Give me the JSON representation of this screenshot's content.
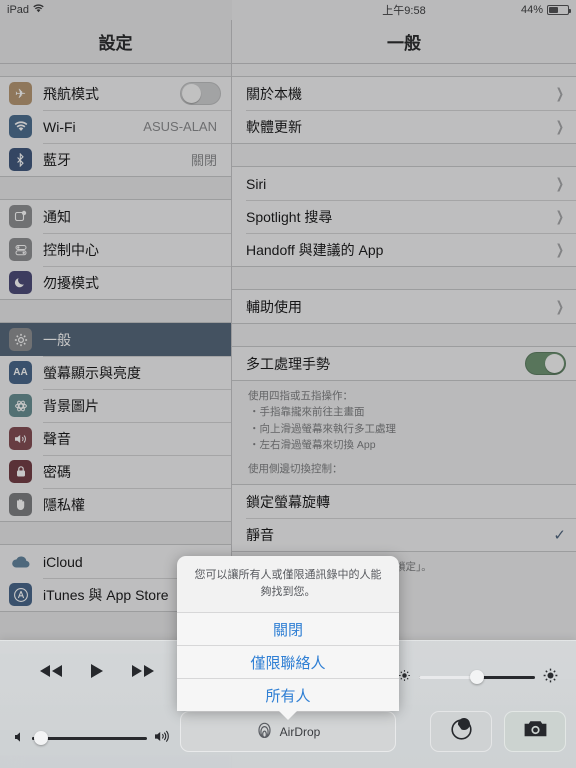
{
  "status_bar": {
    "device": "iPad",
    "wifi_icon": "wifi-icon",
    "time": "上午9:58",
    "battery_percent": "44%",
    "battery_level": 44
  },
  "sidebar": {
    "title": "設定",
    "groups": [
      {
        "items": [
          {
            "label": "飛航模式",
            "icon": "airplane-icon",
            "icon_color": "#e8922b",
            "control": "toggle",
            "toggle_on": false
          },
          {
            "label": "Wi-Fi",
            "icon": "wifi-icon",
            "icon_color": "#1a78d8",
            "value": "ASUS-ALAN"
          },
          {
            "label": "藍牙",
            "icon": "bluetooth-icon",
            "icon_color": "#1a5fc8",
            "value": "關閉"
          }
        ]
      },
      {
        "items": [
          {
            "label": "通知",
            "icon": "notifications-icon",
            "icon_color": "#8e9199"
          },
          {
            "label": "控制中心",
            "icon": "control-center-icon",
            "icon_color": "#8e9199"
          },
          {
            "label": "勿擾模式",
            "icon": "moon-icon",
            "icon_color": "#4b46c7"
          }
        ]
      },
      {
        "items": [
          {
            "label": "一般",
            "icon": "gear-icon",
            "icon_color": "#8e9199",
            "selected": true
          },
          {
            "label": "螢幕顯示與亮度",
            "icon": "display-brightness-icon",
            "icon_color": "#1a6fd4"
          },
          {
            "label": "背景圖片",
            "icon": "wallpaper-icon",
            "icon_color": "#2f9fa8"
          },
          {
            "label": "聲音",
            "icon": "sound-icon",
            "icon_color": "#d3374c"
          },
          {
            "label": "密碼",
            "icon": "lock-icon",
            "icon_color": "#c0293e"
          },
          {
            "label": "隱私權",
            "icon": "privacy-hand-icon",
            "icon_color": "#7d8089"
          }
        ]
      },
      {
        "items": [
          {
            "label": "iCloud",
            "icon": "icloud-icon",
            "icon_color": "#2f8fd8"
          },
          {
            "label": "iTunes 與 App Store",
            "icon": "app-store-icon",
            "icon_color": "#1a6fd4"
          }
        ]
      }
    ]
  },
  "content": {
    "title": "一般",
    "groups": [
      {
        "rows": [
          {
            "label": "關於本機",
            "accessory": "chevron"
          },
          {
            "label": "軟體更新",
            "accessory": "chevron"
          }
        ]
      },
      {
        "rows": [
          {
            "label": "Siri",
            "accessory": "chevron"
          },
          {
            "label": "Spotlight 搜尋",
            "accessory": "chevron"
          },
          {
            "label": "Handoff 與建議的 App",
            "accessory": "chevron"
          }
        ]
      },
      {
        "rows": [
          {
            "label": "輔助使用",
            "accessory": "chevron"
          }
        ]
      },
      {
        "rows": [
          {
            "label": "多工處理手勢",
            "accessory": "toggle",
            "toggle_on": true
          }
        ],
        "footer": {
          "heading": "使用四指或五指操作：",
          "bullets": [
            "・手指靠攏來前往主畫面",
            "・向上滑過螢幕來執行多工處理",
            "・左右滑過螢幕來切換 App"
          ],
          "trailing": "使用側邊切換控制："
        }
      },
      {
        "rows": [
          {
            "label": "鎖定螢幕旋轉",
            "accessory": "none"
          },
          {
            "label": "靜音",
            "accessory": "check"
          }
        ],
        "footer": {
          "heading": "可以在「控制中心」設定「旋轉鎖定」。",
          "bullets": [],
          "trailing": ""
        }
      }
    ]
  },
  "control_center": {
    "media": {
      "rewind_icon": "rewind-icon",
      "play_icon": "play-icon",
      "forward_icon": "fast-forward-icon"
    },
    "brightness": {
      "label_low_icon": "brightness-low-icon",
      "label_high_icon": "brightness-high-icon",
      "value": 50
    },
    "volume": {
      "mute_icon": "volume-low-icon",
      "max_icon": "volume-high-icon",
      "value": 8
    },
    "airdrop": {
      "label": "AirDrop",
      "icon": "airdrop-icon"
    },
    "timer": {
      "icon": "timer-icon"
    },
    "camera": {
      "icon": "camera-icon"
    }
  },
  "popover": {
    "message": "您可以讓所有人或僅限通訊錄中的人能夠找到您。",
    "options": [
      {
        "label": "關閉"
      },
      {
        "label": "僅限聯絡人"
      },
      {
        "label": "所有人"
      }
    ]
  },
  "colors": {
    "selection_blue": "#3a6ea5",
    "toggle_on_green": "#3ea94b",
    "link_blue": "#2f7fd4",
    "check_blue": "#2f6bb5"
  }
}
